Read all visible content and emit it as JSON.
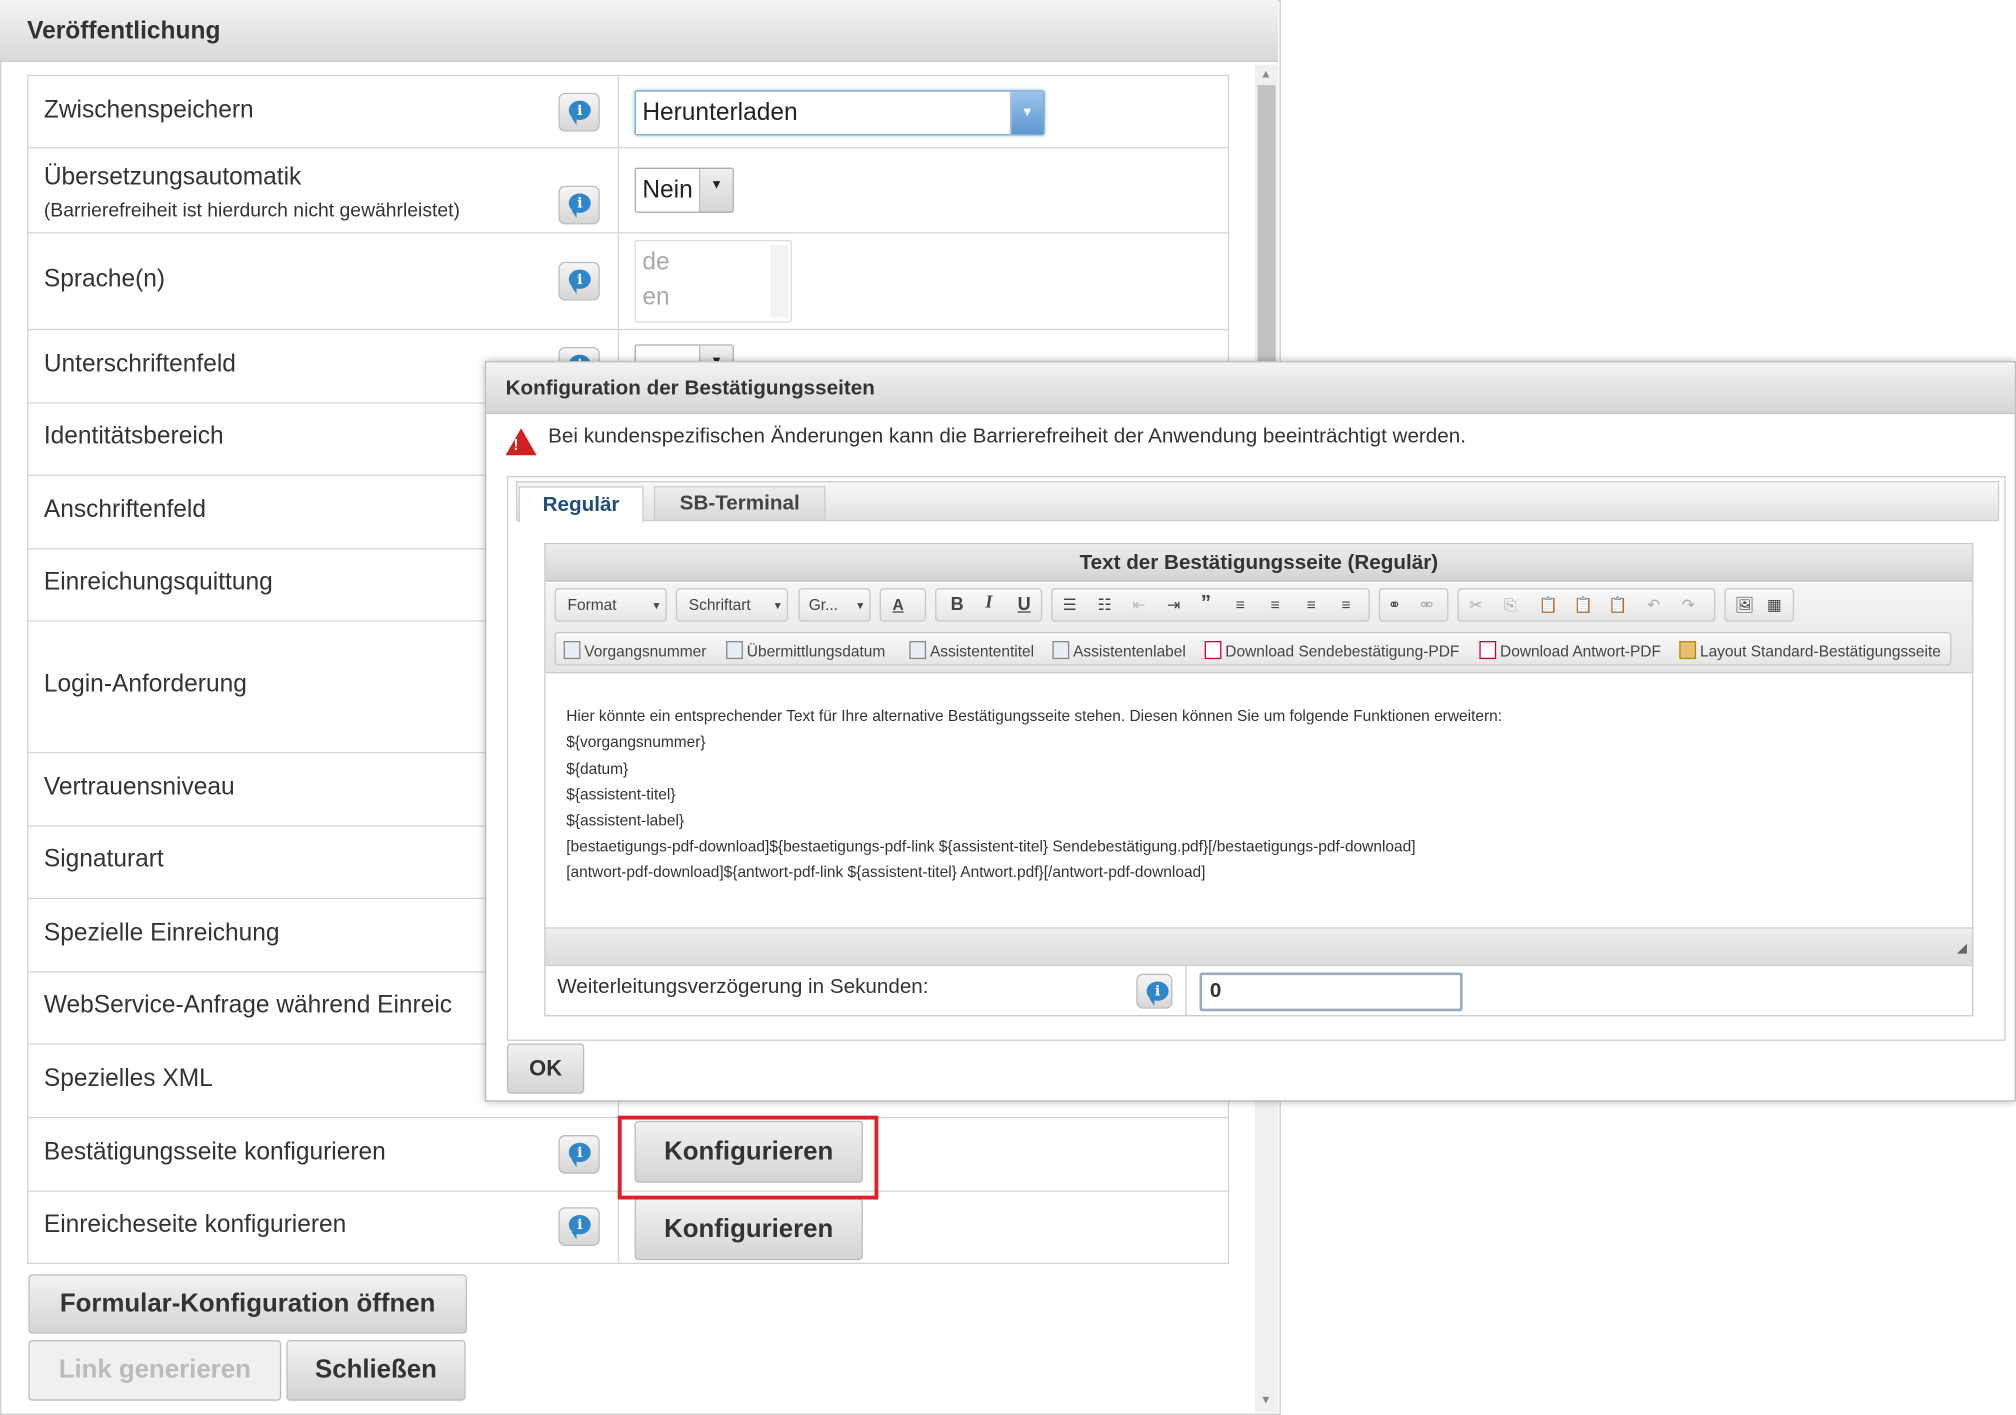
{
  "panel": {
    "title": "Veröffentlichung",
    "rows": [
      {
        "label": "Zwischenspeichern",
        "value": "Herunterladen"
      },
      {
        "label": "Übersetzungsautomatik",
        "sublabel": "(Barrierefreiheit ist hierdurch nicht gewährleistet)",
        "value": "Nein"
      },
      {
        "label": "Sprache(n)",
        "options": [
          "de",
          "en"
        ]
      },
      {
        "label": "Unterschriftenfeld"
      },
      {
        "label": "Identitätsbereich"
      },
      {
        "label": "Anschriftenfeld"
      },
      {
        "label": "Einreichungsquittung"
      },
      {
        "label": "Login-Anforderung"
      },
      {
        "label": "Vertrauensniveau"
      },
      {
        "label": "Signaturart"
      },
      {
        "label": "Spezielle Einreichung"
      },
      {
        "label": "WebService-Anfrage während Einreic"
      },
      {
        "label": "Spezielles XML"
      },
      {
        "label": "Bestätigungsseite konfigurieren",
        "button": "Konfigurieren"
      },
      {
        "label": "Einreicheseite konfigurieren",
        "button": "Konfigurieren"
      }
    ],
    "open_config": "Formular-Konfiguration öffnen",
    "link": "Link generieren",
    "close": "Schließen"
  },
  "dialog": {
    "title": "Konfiguration der Bestätigungsseiten",
    "warning": "Bei kundenspezifischen Änderungen kann die Barrierefreiheit der Anwendung beeinträchtigt werden.",
    "tabs": [
      "Regulär",
      "SB-Terminal"
    ],
    "active_tab": "Regulär",
    "editor_title": "Text der Bestätigungsseite (Regulär)",
    "toolbar": {
      "format": "Format",
      "font": "Schriftart",
      "size": "Gr..."
    },
    "inserts": [
      "Vorgangsnummer",
      "Übermittlungsdatum",
      "Assistententitel",
      "Assistentenlabel",
      "Download Sendebestätigung-PDF",
      "Download Antwort-PDF",
      "Layout Standard-Bestätigungsseite"
    ],
    "content": [
      "Hier könnte ein entsprechender Text für Ihre alternative Bestätigungsseite stehen. Diesen können Sie um folgende Funktionen erweitern:",
      "${vorgangsnummer}",
      "${datum}",
      "${assistent-titel}",
      "${assistent-label}",
      "[bestaetigungs-pdf-download]${bestaetigungs-pdf-link ${assistent-titel} Sendebestätigung.pdf}[/bestaetigungs-pdf-download]",
      "[antwort-pdf-download]${antwort-pdf-link ${assistent-titel} Antwort.pdf}[/antwort-pdf-download]"
    ],
    "delay_label": "Weiterleitungsverzögerung in Sekunden:",
    "delay_value": "0",
    "ok": "OK"
  },
  "colors": {
    "highlight": "#e0202a",
    "info": "#2f86c9"
  }
}
